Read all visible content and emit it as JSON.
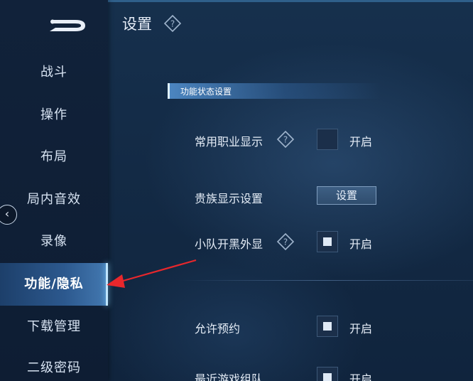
{
  "page": {
    "title": "设置"
  },
  "sidebar": {
    "items": [
      {
        "label": "战斗"
      },
      {
        "label": "操作"
      },
      {
        "label": "布局"
      },
      {
        "label": "局内音效"
      },
      {
        "label": "录像"
      },
      {
        "label": "功能/隐私",
        "active": true
      },
      {
        "label": "下载管理"
      },
      {
        "label": "二级密码"
      }
    ],
    "collapse_glyph": "‹"
  },
  "section": {
    "header": "功能状态设置"
  },
  "settings": {
    "common_role_display": {
      "label": "常用职业显示",
      "state": "开启",
      "checked": false
    },
    "noble_display": {
      "label": "贵族显示设置",
      "button": "设置"
    },
    "squad_appearance": {
      "label": "小队开黑外显",
      "state": "开启",
      "checked": true
    },
    "allow_reservation": {
      "label": "允许预约",
      "state": "开启",
      "checked": true
    },
    "recent_team": {
      "label": "最近游戏组队",
      "state": "开启",
      "checked": true
    }
  },
  "icons": {
    "help": "help-diamond-icon",
    "logo": "game-logo-icon",
    "collapse": "chevron-left-icon",
    "annotation": "red-arrow-annotation"
  },
  "colors": {
    "accent": "#7fd0ff",
    "annotation": "#e8272c"
  }
}
